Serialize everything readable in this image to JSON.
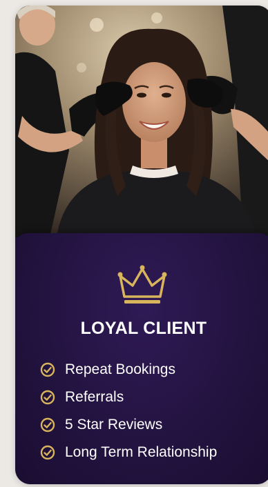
{
  "card": {
    "title": "LOYAL CLIENT",
    "accent_color": "#d8b45c",
    "title_color": "#ffffff",
    "panel_color": "#23143f",
    "icon": "crown-icon",
    "features": [
      {
        "label": "Repeat Bookings",
        "icon": "check-circle-icon"
      },
      {
        "label": "Referrals",
        "icon": "check-circle-icon"
      },
      {
        "label": "5 Star Reviews",
        "icon": "check-circle-icon"
      },
      {
        "label": "Long Term Relationship",
        "icon": "check-circle-icon"
      }
    ]
  }
}
